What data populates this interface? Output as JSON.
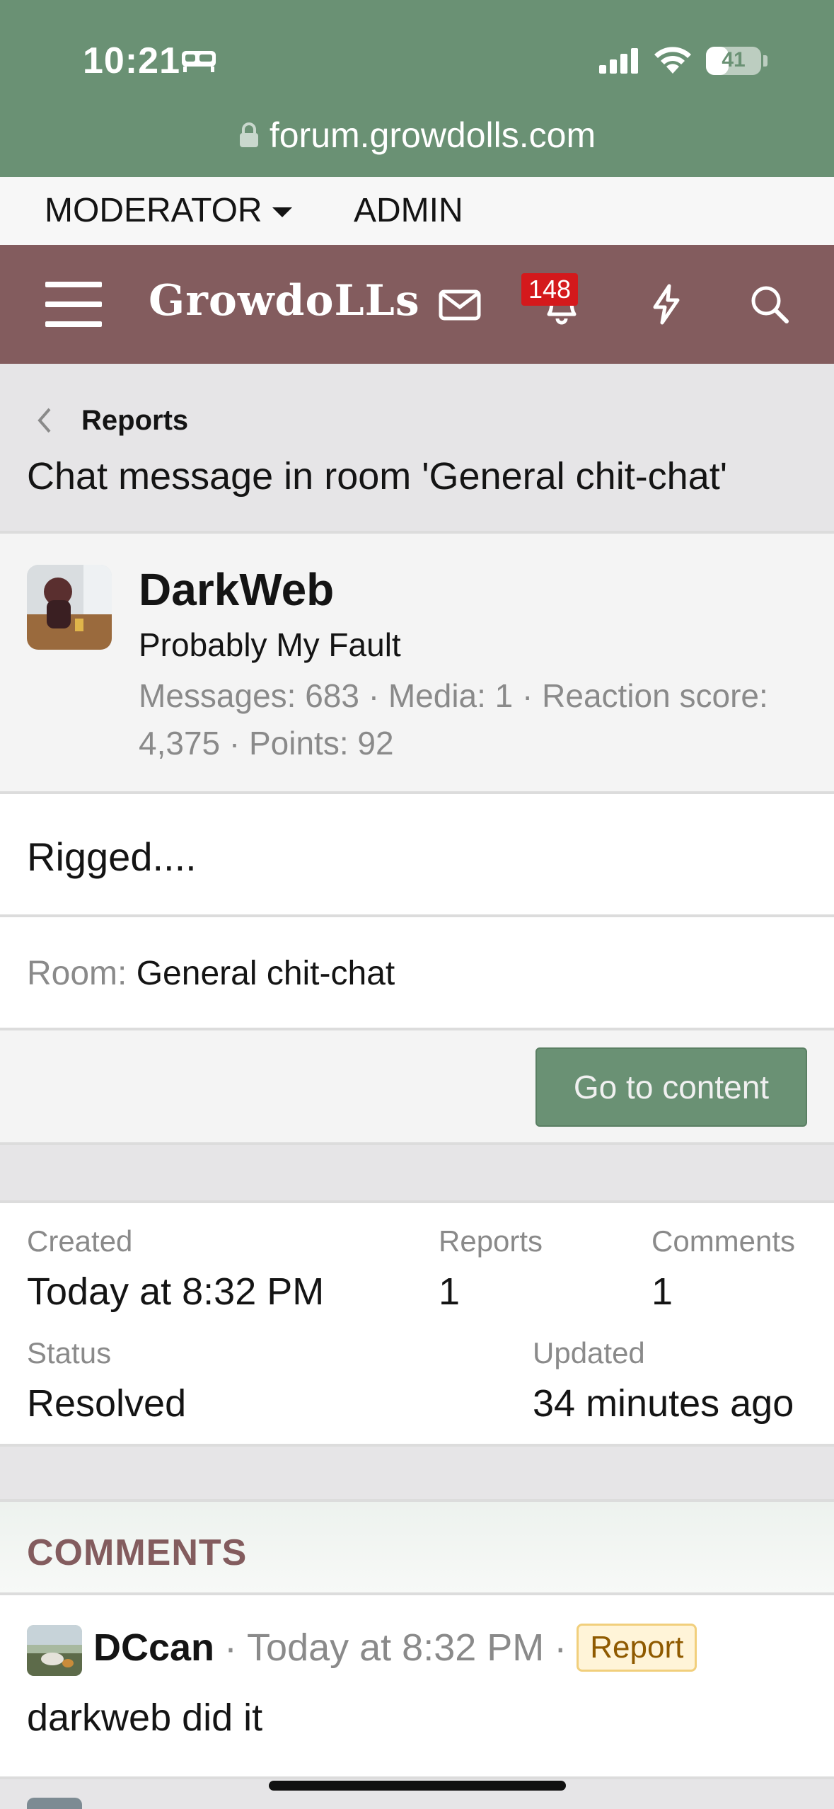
{
  "status_bar": {
    "time": "10:21",
    "battery_level": "41",
    "battery_fraction": 0.41,
    "url": "forum.growdolls.com",
    "icons": [
      "bed-icon",
      "signal-icon",
      "wifi-icon",
      "battery-icon",
      "lock-icon"
    ]
  },
  "staff_bar": {
    "moderator": "MODERATOR",
    "admin": "ADMIN"
  },
  "nav": {
    "logo": "GrowdoLLs",
    "alerts_count": "148",
    "icons": [
      "menu-icon",
      "envelope-icon",
      "bell-icon",
      "lightning-icon",
      "search-icon"
    ],
    "colors": {
      "header": "#835c5e",
      "accent": "#6a9174",
      "badge": "#d4191c"
    }
  },
  "breadcrumb": {
    "label": "Reports",
    "title": "Chat message in room 'General chit-chat'"
  },
  "user": {
    "name": "DarkWeb",
    "title": "Probably My Fault",
    "stats": "Messages: 683 · Media: 1 · Reaction score: 4,375 · Points: 92"
  },
  "message": {
    "text": "Rigged...."
  },
  "room": {
    "label": "Room:",
    "value": "General chit-chat"
  },
  "actions": {
    "go_to_content": "Go to content"
  },
  "info": {
    "created_label": "Created",
    "created_value": "Today at 8:32 PM",
    "reports_label": "Reports",
    "reports_value": "1",
    "comments_label": "Comments",
    "comments_value": "1",
    "status_label": "Status",
    "status_value": "Resolved",
    "updated_label": "Updated",
    "updated_value": "34 minutes ago"
  },
  "comments": {
    "heading": "COMMENTS",
    "items": [
      {
        "user": "DCcan",
        "sep": "·",
        "time": "Today at 8:32 PM",
        "tag": "Report",
        "body": "darkweb did it"
      }
    ]
  }
}
